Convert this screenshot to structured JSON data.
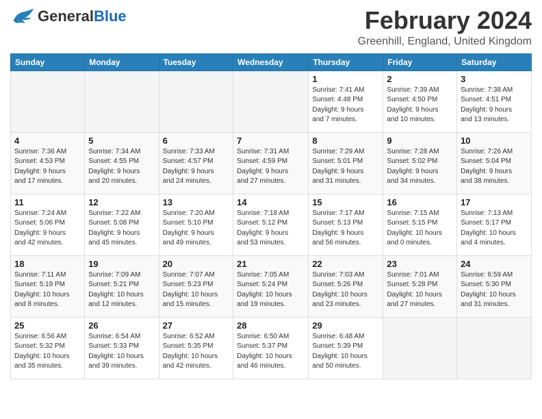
{
  "header": {
    "logo_general": "General",
    "logo_blue": "Blue",
    "month_year": "February 2024",
    "location": "Greenhill, England, United Kingdom"
  },
  "days_of_week": [
    "Sunday",
    "Monday",
    "Tuesday",
    "Wednesday",
    "Thursday",
    "Friday",
    "Saturday"
  ],
  "weeks": [
    [
      {
        "day": "",
        "info": ""
      },
      {
        "day": "",
        "info": ""
      },
      {
        "day": "",
        "info": ""
      },
      {
        "day": "",
        "info": ""
      },
      {
        "day": "1",
        "info": "Sunrise: 7:41 AM\nSunset: 4:48 PM\nDaylight: 9 hours\nand 7 minutes."
      },
      {
        "day": "2",
        "info": "Sunrise: 7:39 AM\nSunset: 4:50 PM\nDaylight: 9 hours\nand 10 minutes."
      },
      {
        "day": "3",
        "info": "Sunrise: 7:38 AM\nSunset: 4:51 PM\nDaylight: 9 hours\nand 13 minutes."
      }
    ],
    [
      {
        "day": "4",
        "info": "Sunrise: 7:36 AM\nSunset: 4:53 PM\nDaylight: 9 hours\nand 17 minutes."
      },
      {
        "day": "5",
        "info": "Sunrise: 7:34 AM\nSunset: 4:55 PM\nDaylight: 9 hours\nand 20 minutes."
      },
      {
        "day": "6",
        "info": "Sunrise: 7:33 AM\nSunset: 4:57 PM\nDaylight: 9 hours\nand 24 minutes."
      },
      {
        "day": "7",
        "info": "Sunrise: 7:31 AM\nSunset: 4:59 PM\nDaylight: 9 hours\nand 27 minutes."
      },
      {
        "day": "8",
        "info": "Sunrise: 7:29 AM\nSunset: 5:01 PM\nDaylight: 9 hours\nand 31 minutes."
      },
      {
        "day": "9",
        "info": "Sunrise: 7:28 AM\nSunset: 5:02 PM\nDaylight: 9 hours\nand 34 minutes."
      },
      {
        "day": "10",
        "info": "Sunrise: 7:26 AM\nSunset: 5:04 PM\nDaylight: 9 hours\nand 38 minutes."
      }
    ],
    [
      {
        "day": "11",
        "info": "Sunrise: 7:24 AM\nSunset: 5:06 PM\nDaylight: 9 hours\nand 42 minutes."
      },
      {
        "day": "12",
        "info": "Sunrise: 7:22 AM\nSunset: 5:08 PM\nDaylight: 9 hours\nand 45 minutes."
      },
      {
        "day": "13",
        "info": "Sunrise: 7:20 AM\nSunset: 5:10 PM\nDaylight: 9 hours\nand 49 minutes."
      },
      {
        "day": "14",
        "info": "Sunrise: 7:18 AM\nSunset: 5:12 PM\nDaylight: 9 hours\nand 53 minutes."
      },
      {
        "day": "15",
        "info": "Sunrise: 7:17 AM\nSunset: 5:13 PM\nDaylight: 9 hours\nand 56 minutes."
      },
      {
        "day": "16",
        "info": "Sunrise: 7:15 AM\nSunset: 5:15 PM\nDaylight: 10 hours\nand 0 minutes."
      },
      {
        "day": "17",
        "info": "Sunrise: 7:13 AM\nSunset: 5:17 PM\nDaylight: 10 hours\nand 4 minutes."
      }
    ],
    [
      {
        "day": "18",
        "info": "Sunrise: 7:11 AM\nSunset: 5:19 PM\nDaylight: 10 hours\nand 8 minutes."
      },
      {
        "day": "19",
        "info": "Sunrise: 7:09 AM\nSunset: 5:21 PM\nDaylight: 10 hours\nand 12 minutes."
      },
      {
        "day": "20",
        "info": "Sunrise: 7:07 AM\nSunset: 5:23 PM\nDaylight: 10 hours\nand 15 minutes."
      },
      {
        "day": "21",
        "info": "Sunrise: 7:05 AM\nSunset: 5:24 PM\nDaylight: 10 hours\nand 19 minutes."
      },
      {
        "day": "22",
        "info": "Sunrise: 7:03 AM\nSunset: 5:26 PM\nDaylight: 10 hours\nand 23 minutes."
      },
      {
        "day": "23",
        "info": "Sunrise: 7:01 AM\nSunset: 5:28 PM\nDaylight: 10 hours\nand 27 minutes."
      },
      {
        "day": "24",
        "info": "Sunrise: 6:59 AM\nSunset: 5:30 PM\nDaylight: 10 hours\nand 31 minutes."
      }
    ],
    [
      {
        "day": "25",
        "info": "Sunrise: 6:56 AM\nSunset: 5:32 PM\nDaylight: 10 hours\nand 35 minutes."
      },
      {
        "day": "26",
        "info": "Sunrise: 6:54 AM\nSunset: 5:33 PM\nDaylight: 10 hours\nand 39 minutes."
      },
      {
        "day": "27",
        "info": "Sunrise: 6:52 AM\nSunset: 5:35 PM\nDaylight: 10 hours\nand 42 minutes."
      },
      {
        "day": "28",
        "info": "Sunrise: 6:50 AM\nSunset: 5:37 PM\nDaylight: 10 hours\nand 46 minutes."
      },
      {
        "day": "29",
        "info": "Sunrise: 6:48 AM\nSunset: 5:39 PM\nDaylight: 10 hours\nand 50 minutes."
      },
      {
        "day": "",
        "info": ""
      },
      {
        "day": "",
        "info": ""
      }
    ]
  ]
}
